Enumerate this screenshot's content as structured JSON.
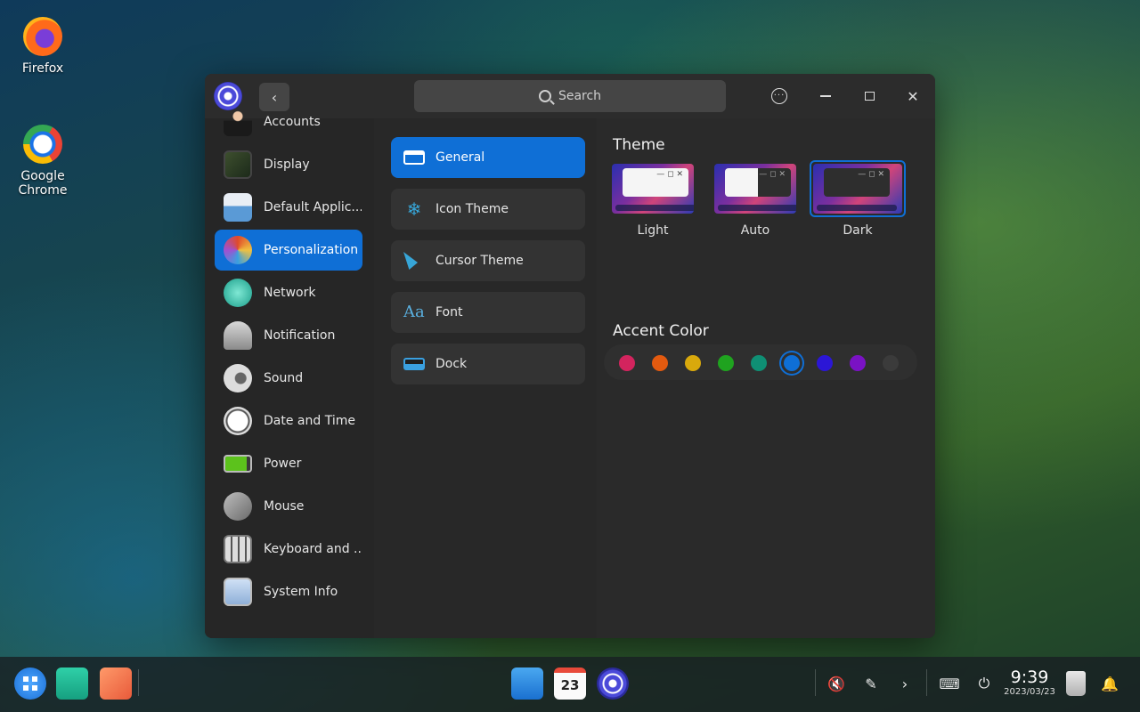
{
  "desktop": {
    "icons": [
      {
        "label": "Firefox"
      },
      {
        "label": "Google Chrome"
      }
    ]
  },
  "window": {
    "search_placeholder": "Search",
    "back_glyph": "‹",
    "more_glyph": "···",
    "close_glyph": "✕"
  },
  "sidebar": {
    "items": [
      {
        "label": "Accounts",
        "icon": "accounts-icon"
      },
      {
        "label": "Display",
        "icon": "display-icon"
      },
      {
        "label": "Default Applic...",
        "icon": "default-applications-icon"
      },
      {
        "label": "Personalization",
        "icon": "personalization-icon",
        "active": true
      },
      {
        "label": "Network",
        "icon": "network-icon"
      },
      {
        "label": "Notification",
        "icon": "notification-icon"
      },
      {
        "label": "Sound",
        "icon": "sound-icon"
      },
      {
        "label": "Date and Time",
        "icon": "date-time-icon"
      },
      {
        "label": "Power",
        "icon": "power-icon"
      },
      {
        "label": "Mouse",
        "icon": "mouse-icon"
      },
      {
        "label": "Keyboard and ...",
        "icon": "keyboard-icon"
      },
      {
        "label": "System Info",
        "icon": "system-info-icon"
      }
    ]
  },
  "subnav": {
    "items": [
      {
        "label": "General",
        "active": true
      },
      {
        "label": "Icon Theme"
      },
      {
        "label": "Cursor Theme"
      },
      {
        "label": "Font"
      },
      {
        "label": "Dock"
      }
    ]
  },
  "content": {
    "theme_title": "Theme",
    "themes": [
      {
        "label": "Light"
      },
      {
        "label": "Auto"
      },
      {
        "label": "Dark",
        "selected": true
      }
    ],
    "theme_window_controls": "—  ◻  ✕",
    "accent_title": "Accent Color",
    "accent_colors": [
      "#d3245e",
      "#e35a0f",
      "#d9a90c",
      "#1fa31f",
      "#0f8f74",
      "#0f6fd6",
      "#2b16d6",
      "#7a12c4",
      "#3b3b3b"
    ],
    "accent_selected_index": 5
  },
  "taskbar": {
    "time": "9:39",
    "date": "2023/03/23",
    "calendar_day": "23"
  }
}
